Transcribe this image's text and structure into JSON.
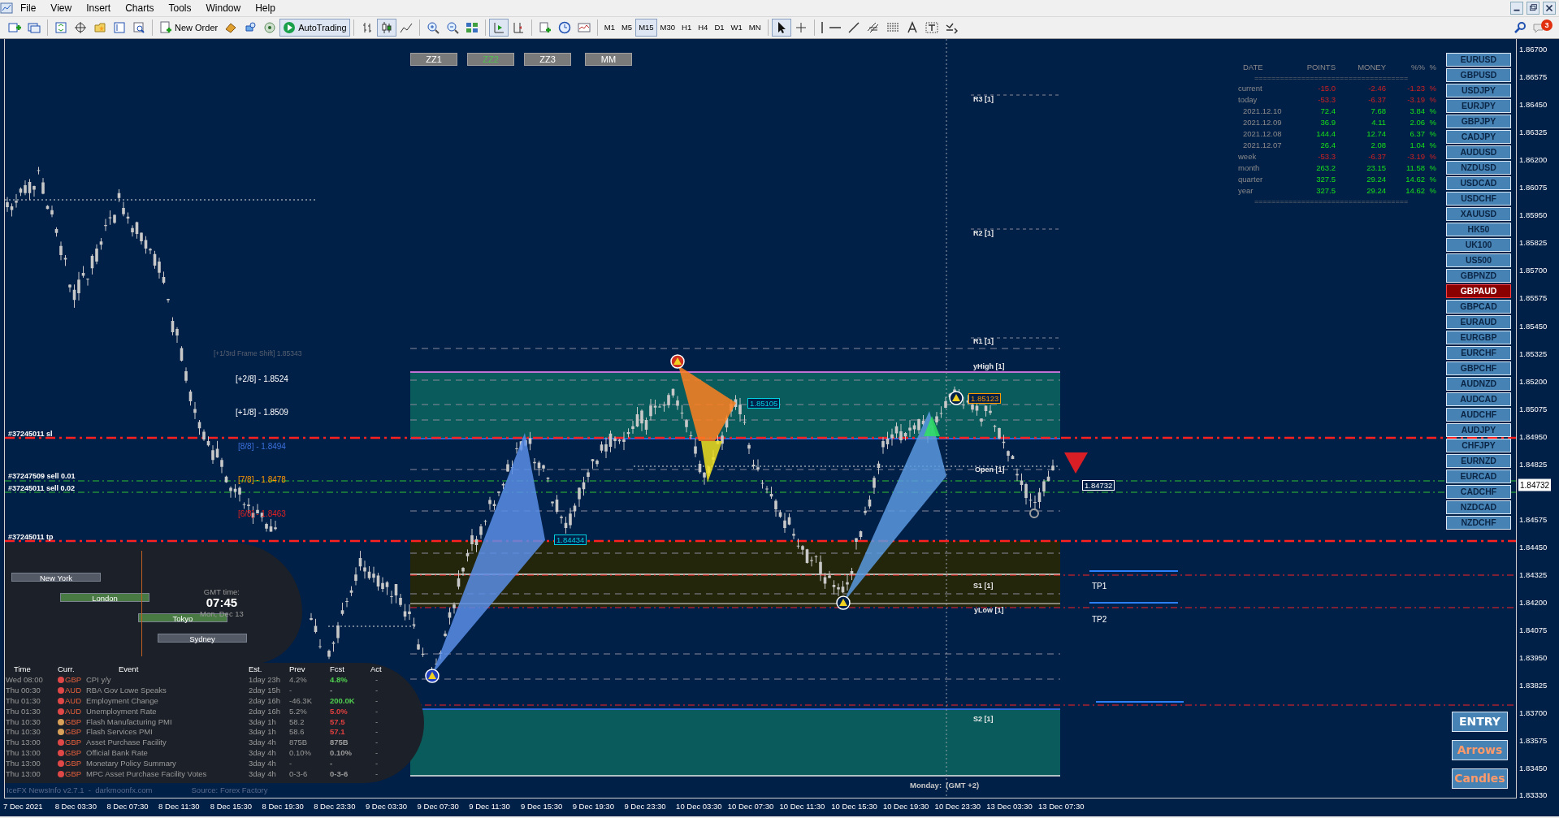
{
  "menu": [
    "File",
    "View",
    "Insert",
    "Charts",
    "Tools",
    "Window",
    "Help"
  ],
  "toolbar": {
    "new_order": "New Order",
    "autotrading": "AutoTrading",
    "timeframes": [
      {
        "label": "M1",
        "selected": false
      },
      {
        "label": "M5",
        "selected": false
      },
      {
        "label": "M15",
        "selected": true
      },
      {
        "label": "M30",
        "selected": false
      },
      {
        "label": "H1",
        "selected": false
      },
      {
        "label": "H4",
        "selected": false
      },
      {
        "label": "D1",
        "selected": false
      },
      {
        "label": "W1",
        "selected": false
      },
      {
        "label": "MN",
        "selected": false
      }
    ],
    "notifications": "3"
  },
  "chart": {
    "pattern_buttons": [
      {
        "label": "ZZ1",
        "selected": false
      },
      {
        "label": "ZZ2",
        "selected": true
      },
      {
        "label": "ZZ3",
        "selected": false
      },
      {
        "label": "MM",
        "selected": false
      }
    ],
    "murrey_levels": [
      {
        "text": "[+1/3rd Frame Shift]  1.85343",
        "color": "#5a6270"
      },
      {
        "text": "[+2/8] - 1.8524",
        "color": "#ffffff"
      },
      {
        "text": "[+1/8] - 1.8509",
        "color": "#ffffff"
      },
      {
        "text": "[8/8] - 1.8494",
        "color": "#3a6fd8"
      },
      {
        "text": "[7/8] - 1.8478",
        "color": "#ff9900"
      },
      {
        "text": "[6/8] - 1.8463",
        "color": "#e02020"
      }
    ],
    "order_labels": [
      "#37245011 sl",
      "#37247509 sell 0.01",
      "#37245011 sell 0.02",
      "#37245011 tp"
    ],
    "pivot_labels": [
      "R3 [1]",
      "R2 [1]",
      "R1 [1]",
      "yHigh [1]",
      "Open [1]",
      "S1 [1]",
      "yLow [1]",
      "S2 [1]"
    ],
    "take_profits": [
      "TP1",
      "TP2"
    ],
    "price_tags": [
      {
        "text": "1.85105",
        "color": "#00d0e0"
      },
      {
        "text": "1.85123",
        "color": "#ff9900"
      },
      {
        "text": "1.84434",
        "color": "#00d0e0"
      },
      {
        "text": "1.84732",
        "color": "#ffffff"
      }
    ],
    "session_note": "Monday:  (GMT +2)"
  },
  "stats": {
    "columns": [
      "DATE",
      "POINTS",
      "MONEY",
      "%%",
      "%"
    ],
    "rule": "====================================",
    "rows": [
      {
        "label": "current",
        "points": "-15.0",
        "money": "-2.46",
        "percent": "-1.23",
        "unit": "%",
        "kind": "loss"
      },
      {
        "label": "today",
        "points": "-53.3",
        "money": "-6.37",
        "percent": "-3.19",
        "unit": "%",
        "kind": "loss"
      },
      {
        "label": "2021.12.10",
        "points": "72.4",
        "money": "7.68",
        "percent": "3.84",
        "unit": "%",
        "kind": "gain"
      },
      {
        "label": "2021.12.09",
        "points": "36.9",
        "money": "4.11",
        "percent": "2.06",
        "unit": "%",
        "kind": "gain"
      },
      {
        "label": "2021.12.08",
        "points": "144.4",
        "money": "12.74",
        "percent": "6.37",
        "unit": "%",
        "kind": "gain"
      },
      {
        "label": "2021.12.07",
        "points": "26.4",
        "money": "2.08",
        "percent": "1.04",
        "unit": "%",
        "kind": "gain"
      },
      {
        "label": "week",
        "points": "-53.3",
        "money": "-6.37",
        "percent": "-3.19",
        "unit": "%",
        "kind": "loss"
      },
      {
        "label": "month",
        "points": "263.2",
        "money": "23.15",
        "percent": "11.58",
        "unit": "%",
        "kind": "gain"
      },
      {
        "label": "quarter",
        "points": "327.5",
        "money": "29.24",
        "percent": "14.62",
        "unit": "%",
        "kind": "gain"
      },
      {
        "label": "year",
        "points": "327.5",
        "money": "29.24",
        "percent": "14.62",
        "unit": "%",
        "kind": "gain"
      }
    ]
  },
  "symbols": [
    {
      "label": "EURUSD",
      "selected": false
    },
    {
      "label": "GBPUSD",
      "selected": false
    },
    {
      "label": "USDJPY",
      "selected": false
    },
    {
      "label": "EURJPY",
      "selected": false
    },
    {
      "label": "GBPJPY",
      "selected": false
    },
    {
      "label": "CADJPY",
      "selected": false
    },
    {
      "label": "AUDUSD",
      "selected": false
    },
    {
      "label": "NZDUSD",
      "selected": false
    },
    {
      "label": "USDCAD",
      "selected": false
    },
    {
      "label": "USDCHF",
      "selected": false
    },
    {
      "label": "XAUUSD",
      "selected": false
    },
    {
      "label": "HK50",
      "selected": false
    },
    {
      "label": "UK100",
      "selected": false
    },
    {
      "label": "US500",
      "selected": false
    },
    {
      "label": "GBPNZD",
      "selected": false
    },
    {
      "label": "GBPAUD",
      "selected": true
    },
    {
      "label": "GBPCAD",
      "selected": false
    },
    {
      "label": "EURAUD",
      "selected": false
    },
    {
      "label": "EURGBP",
      "selected": false
    },
    {
      "label": "EURCHF",
      "selected": false
    },
    {
      "label": "GBPCHF",
      "selected": false
    },
    {
      "label": "AUDNZD",
      "selected": false
    },
    {
      "label": "AUDCAD",
      "selected": false
    },
    {
      "label": "AUDCHF",
      "selected": false
    },
    {
      "label": "AUDJPY",
      "selected": false
    },
    {
      "label": "CHFJPY",
      "selected": false
    },
    {
      "label": "EURNZD",
      "selected": false
    },
    {
      "label": "EURCAD",
      "selected": false
    },
    {
      "label": "CADCHF",
      "selected": false
    },
    {
      "label": "NZDCAD",
      "selected": false
    },
    {
      "label": "NZDCHF",
      "selected": false
    }
  ],
  "actions": [
    {
      "label": "ENTRY",
      "kind": "primary"
    },
    {
      "label": "Arrows",
      "kind": "toggle"
    },
    {
      "label": "Candles",
      "kind": "toggle"
    }
  ],
  "sessions": {
    "bars": [
      {
        "label": "New York",
        "active": false
      },
      {
        "label": "London",
        "active": true
      },
      {
        "label": "Tokyo",
        "active": true
      },
      {
        "label": "Sydney",
        "active": false
      }
    ],
    "gmt_label": "GMT time:",
    "time": "07:45",
    "date": "Mon, Dec 13"
  },
  "news": {
    "columns": [
      "Time",
      "Curr.",
      "Event",
      "Est.",
      "Prev",
      "Fcst",
      "Act"
    ],
    "rows": [
      {
        "time": "Wed 08:00",
        "color": "#e04848",
        "currency": "GBP",
        "event": "CPI y/y",
        "est": "1day 23h",
        "prev": "4.2%",
        "fcst": {
          "text": "4.8%",
          "color": "#50d050"
        },
        "act": "-"
      },
      {
        "time": "Thu 00:30",
        "color": "#e04848",
        "currency": "AUD",
        "event": "RBA Gov Lowe Speaks",
        "est": "2day 15h",
        "prev": "-",
        "fcst": "-",
        "act": "-"
      },
      {
        "time": "Thu 01:30",
        "color": "#e04848",
        "currency": "AUD",
        "event": "Employment Change",
        "est": "2day 16h",
        "prev": "-46.3K",
        "fcst": {
          "text": "200.0K",
          "color": "#50d050"
        },
        "act": "-"
      },
      {
        "time": "Thu 01:30",
        "color": "#e04848",
        "currency": "AUD",
        "event": "Unemployment Rate",
        "est": "2day 16h",
        "prev": "5.2%",
        "fcst": {
          "text": "5.0%",
          "color": "#e04040"
        },
        "act": "-"
      },
      {
        "time": "Thu 10:30",
        "color": "#d8a058",
        "currency": "GBP",
        "event": "Flash Manufacturing PMI",
        "est": "3day 1h",
        "prev": "58.2",
        "fcst": {
          "text": "57.5",
          "color": "#e04040"
        },
        "act": "-"
      },
      {
        "time": "Thu 10:30",
        "color": "#d8a058",
        "currency": "GBP",
        "event": "Flash Services PMI",
        "est": "3day 1h",
        "prev": "58.6",
        "fcst": {
          "text": "57.1",
          "color": "#e04040"
        },
        "act": "-"
      },
      {
        "time": "Thu 13:00",
        "color": "#e04848",
        "currency": "GBP",
        "event": "Asset Purchase Facility",
        "est": "3day 4h",
        "prev": "875B",
        "fcst": {
          "text": "875B",
          "color": "#9a9a9a"
        },
        "act": "-"
      },
      {
        "time": "Thu 13:00",
        "color": "#e04848",
        "currency": "GBP",
        "event": "Official Bank Rate",
        "est": "3day 4h",
        "prev": "0.10%",
        "fcst": {
          "text": "0.10%",
          "color": "#9a9a9a"
        },
        "act": "-"
      },
      {
        "time": "Thu 13:00",
        "color": "#e04848",
        "currency": "GBP",
        "event": "Monetary Policy Summary",
        "est": "3day 4h",
        "prev": "-",
        "fcst": "-",
        "act": "-"
      },
      {
        "time": "Thu 13:00",
        "color": "#e04848",
        "currency": "GBP",
        "event": "MPC Asset Purchase Facility Votes",
        "est": "3day 4h",
        "prev": "0-3-6",
        "fcst": {
          "text": "0-3-6",
          "color": "#9a9a9a"
        },
        "act": "-"
      }
    ],
    "footer": "IceFX NewsInfo v2.7.1  -  darkmoonfx.com",
    "source": "Source: Forex Factory"
  },
  "price_axis": [
    "1.86700",
    "1.86575",
    "1.86450",
    "1.86325",
    "1.86200",
    "1.86075",
    "1.85950",
    "1.85825",
    "1.85700",
    "1.85575",
    "1.85450",
    "1.85325",
    "1.85200",
    "1.85075",
    "1.84950",
    "1.84825",
    "1.84575",
    "1.84450",
    "1.84325",
    "1.84200",
    "1.84075",
    "1.83950",
    "1.83825",
    "1.83700",
    "1.83575",
    "1.83450",
    "1.83330"
  ],
  "current_price": "1.84732",
  "time_axis": [
    "7 Dec 2021",
    "8 Dec 03:30",
    "8 Dec 07:30",
    "8 Dec 11:30",
    "8 Dec 15:30",
    "8 Dec 19:30",
    "8 Dec 23:30",
    "9 Dec 03:30",
    "9 Dec 07:30",
    "9 Dec 11:30",
    "9 Dec 15:30",
    "9 Dec 19:30",
    "9 Dec 23:30",
    "10 Dec 03:30",
    "10 Dec 07:30",
    "10 Dec 11:30",
    "10 Dec 15:30",
    "10 Dec 19:30",
    "10 Dec 23:30",
    "13 Dec 03:30",
    "13 Dec 07:30"
  ]
}
